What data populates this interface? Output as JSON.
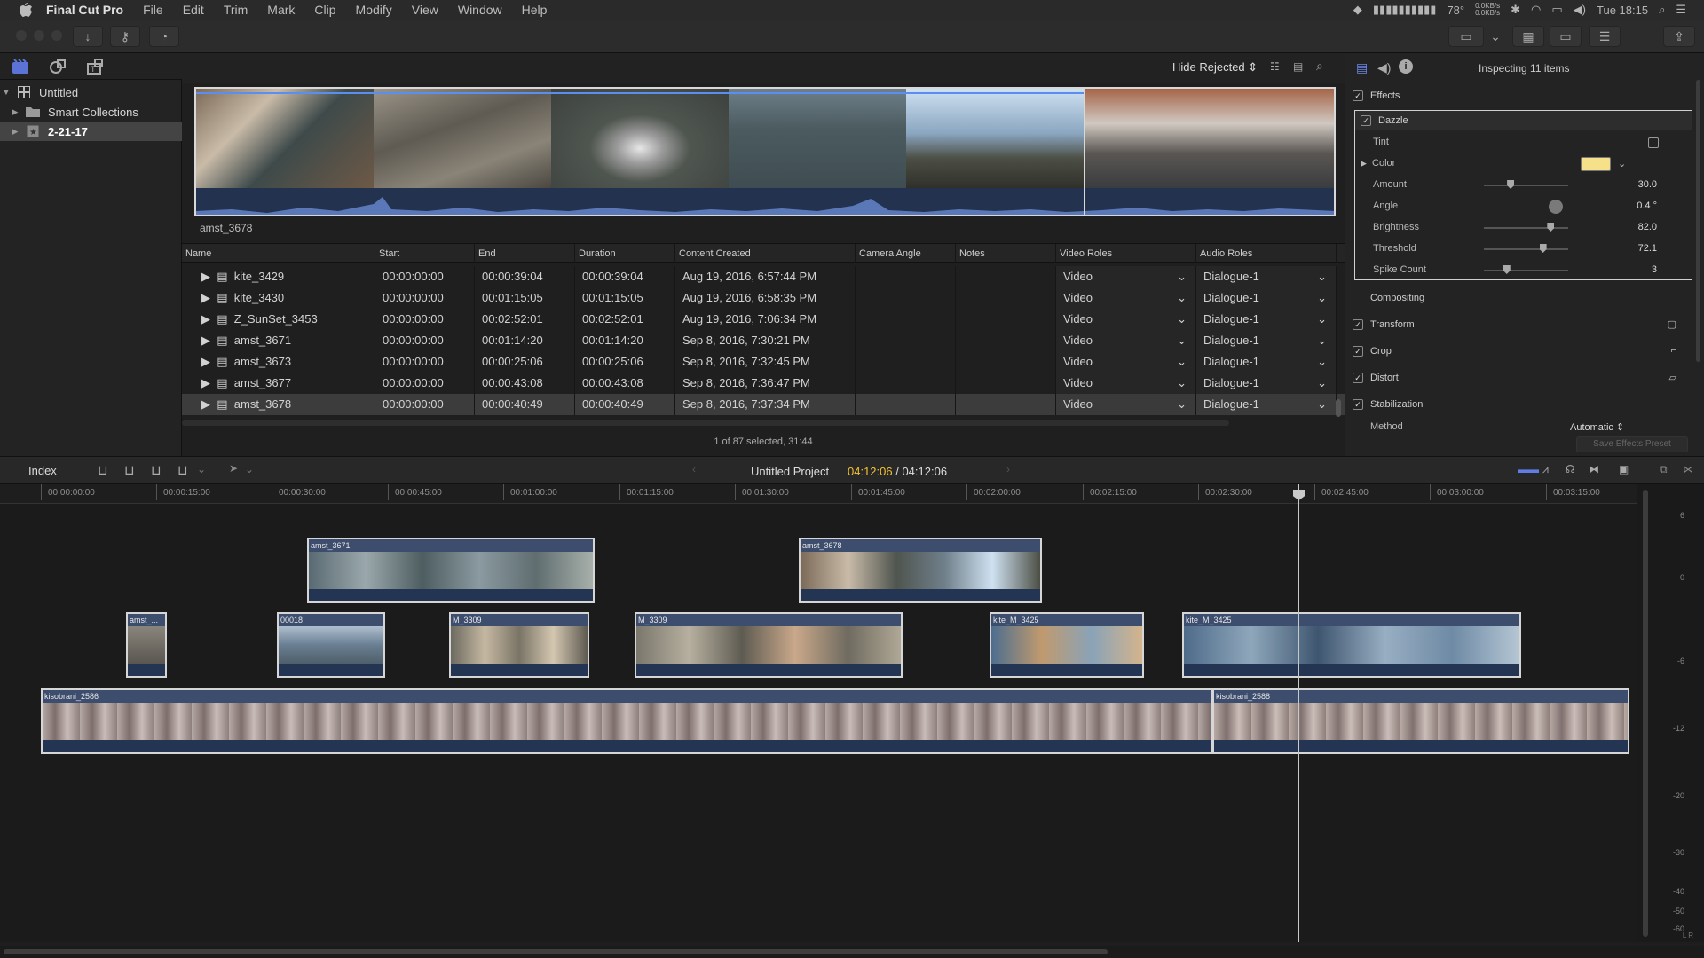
{
  "menubar": {
    "app": "Final Cut Pro",
    "items": [
      "File",
      "Edit",
      "Trim",
      "Mark",
      "Clip",
      "Modify",
      "View",
      "Window",
      "Help"
    ],
    "status": {
      "temp": "78°",
      "net_up": "0.0KB/s",
      "net_down": "0.0KB/s",
      "clock": "Tue 18:15"
    }
  },
  "library": {
    "root": "Untitled",
    "items": [
      {
        "label": "Smart Collections"
      },
      {
        "label": "2-21-17"
      }
    ]
  },
  "browser": {
    "filter": "Hide Rejected",
    "clip_name": "amst_3678",
    "selection_info": "1 of 87 selected, 31:44",
    "columns": [
      "Name",
      "Start",
      "End",
      "Duration",
      "Content Created",
      "Camera Angle",
      "Notes",
      "Video Roles",
      "Audio Roles"
    ],
    "rows": [
      {
        "name": "kite_3429",
        "start": "00:00:00:00",
        "end": "00:00:39:04",
        "duration": "00:00:39:04",
        "created": "Aug 19, 2016, 6:57:44 PM",
        "video": "Video",
        "audio": "Dialogue-1"
      },
      {
        "name": "kite_3430",
        "start": "00:00:00:00",
        "end": "00:01:15:05",
        "duration": "00:01:15:05",
        "created": "Aug 19, 2016, 6:58:35 PM",
        "video": "Video",
        "audio": "Dialogue-1"
      },
      {
        "name": "Z_SunSet_3453",
        "start": "00:00:00:00",
        "end": "00:02:52:01",
        "duration": "00:02:52:01",
        "created": "Aug 19, 2016, 7:06:34 PM",
        "video": "Video",
        "audio": "Dialogue-1"
      },
      {
        "name": "amst_3671",
        "start": "00:00:00:00",
        "end": "00:01:14:20",
        "duration": "00:01:14:20",
        "created": "Sep 8, 2016, 7:30:21 PM",
        "video": "Video",
        "audio": "Dialogue-1"
      },
      {
        "name": "amst_3673",
        "start": "00:00:00:00",
        "end": "00:00:25:06",
        "duration": "00:00:25:06",
        "created": "Sep 8, 2016, 7:32:45 PM",
        "video": "Video",
        "audio": "Dialogue-1"
      },
      {
        "name": "amst_3677",
        "start": "00:00:00:00",
        "end": "00:00:43:08",
        "duration": "00:00:43:08",
        "created": "Sep 8, 2016, 7:36:47 PM",
        "video": "Video",
        "audio": "Dialogue-1"
      },
      {
        "name": "amst_3678",
        "start": "00:00:00:00",
        "end": "00:00:40:49",
        "duration": "00:00:40:49",
        "created": "Sep 8, 2016, 7:37:34 PM",
        "video": "Video",
        "audio": "Dialogue-1"
      }
    ]
  },
  "inspector": {
    "title": "Inspecting 11 items",
    "effects_label": "Effects",
    "effect_name": "Dazzle",
    "params": [
      {
        "label": "Tint",
        "value": ""
      },
      {
        "label": "Color",
        "value": ""
      },
      {
        "label": "Amount",
        "value": "30.0",
        "level": 0.3
      },
      {
        "label": "Angle",
        "value": "0.4 °"
      },
      {
        "label": "Brightness",
        "value": "82.0",
        "level": 0.82
      },
      {
        "label": "Threshold",
        "value": "72.1",
        "level": 0.72
      },
      {
        "label": "Spike Count",
        "value": "3",
        "level": 0.25
      }
    ],
    "compositing": "Compositing",
    "transform": "Transform",
    "crop": "Crop",
    "distort": "Distort",
    "stabilization": "Stabilization",
    "method_label": "Method",
    "method_value": "Automatic",
    "save_preset": "Save Effects Preset",
    "color_swatch": "#f7e08a"
  },
  "timeline": {
    "index_label": "Index",
    "project": "Untitled Project",
    "tc_current": "04:12:06",
    "tc_sep": " / ",
    "tc_total": "04:12:06",
    "ruler": [
      "00:00:00:00",
      "00:00:15:00",
      "00:00:30:00",
      "00:00:45:00",
      "00:01:00:00",
      "00:01:15:00",
      "00:01:30:00",
      "00:01:45:00",
      "00:02:00:00",
      "00:02:15:00",
      "00:02:30:00",
      "00:02:45:00",
      "00:03:00:00",
      "00:03:15:00"
    ],
    "clips": [
      "amst_3671",
      "amst_3678",
      "amst_...",
      "00018",
      "M_3309",
      "M_3309",
      "kite_M_3425",
      "kite_M_3425",
      "kisobrani_2586",
      "kisobrani_2588"
    ],
    "meter": [
      "6",
      "0",
      "-6",
      "-12",
      "-20",
      "-30",
      "-40",
      "-50",
      "-60"
    ],
    "meter_lr": "L R"
  }
}
